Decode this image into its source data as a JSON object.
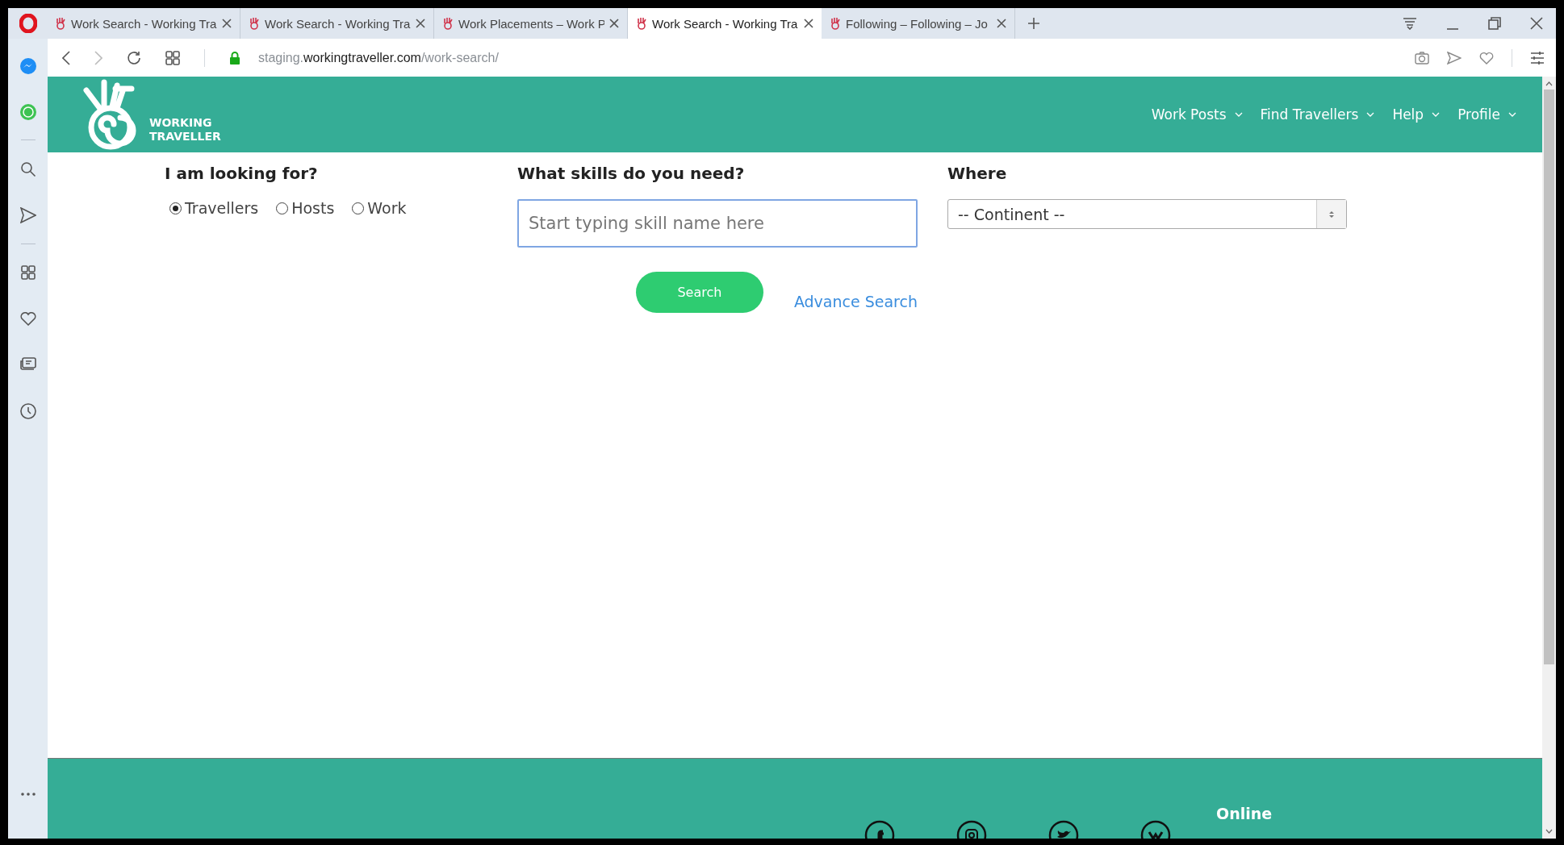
{
  "browser": {
    "tabs": [
      {
        "title": "Work Search - Working Tra",
        "selected": false
      },
      {
        "title": "Work Search - Working Tra",
        "selected": false
      },
      {
        "title": "Work Placements – Work P",
        "selected": false
      },
      {
        "title": "Work Search - Working Tra",
        "selected": true
      },
      {
        "title": "Following – Following – Jo",
        "selected": false
      }
    ],
    "address": {
      "subdomain": "staging.",
      "domain": "workingtraveller.com",
      "path": "/work-search/"
    }
  },
  "site": {
    "logo_lines": [
      "WORKING",
      "TRAVELLER"
    ],
    "nav": [
      {
        "label": "Work Posts"
      },
      {
        "label": "Find Travellers"
      },
      {
        "label": "Help"
      },
      {
        "label": "Profile"
      }
    ]
  },
  "search_form": {
    "type_label": "I am looking for?",
    "types": [
      {
        "label": "Travellers",
        "selected": true
      },
      {
        "label": "Hosts",
        "selected": false
      },
      {
        "label": "Work",
        "selected": false
      }
    ],
    "skills_label": "What skills do you need?",
    "skills_placeholder": "Start typing skill name here",
    "where_label": "Where",
    "continent": "-- Continent --",
    "search_button": "Search",
    "advance_link": "Advance Search"
  },
  "footer": {
    "online_label": "Online"
  }
}
